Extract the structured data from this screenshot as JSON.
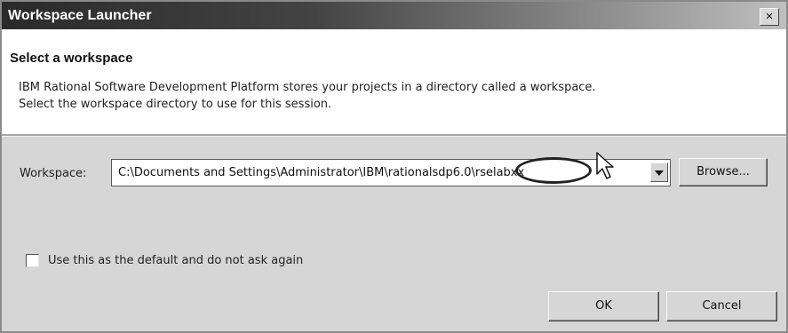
{
  "window": {
    "title": "Workspace Launcher",
    "close_label": "×"
  },
  "header": {
    "title": "Select a workspace",
    "description_line1": "IBM Rational Software Development Platform stores your projects in a directory called a workspace.",
    "description_line2": "Select the workspace directory to use for this session."
  },
  "workspace": {
    "label": "Workspace:",
    "value": "C:\\Documents and Settings\\Administrator\\IBM\\rationalsdp6.0\\rselabxx"
  },
  "buttons": {
    "browse": "Browse...",
    "ok": "OK",
    "cancel": "Cancel"
  },
  "default_checkbox": {
    "label": "Use this as the default and do not ask again",
    "checked": false
  }
}
